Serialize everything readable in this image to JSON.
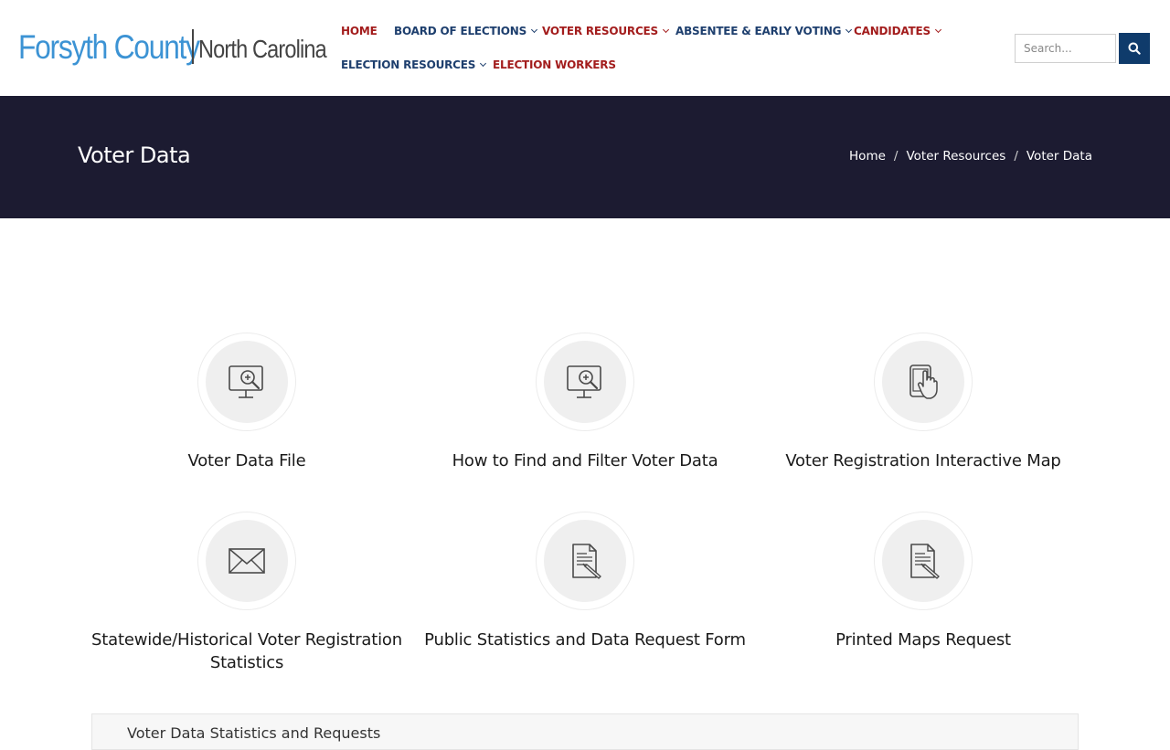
{
  "logo": {
    "county": "Forsyth County",
    "state": "North Carolina"
  },
  "nav": {
    "items": [
      {
        "label": "HOME",
        "dropdown": false
      },
      {
        "label": "BOARD OF ELECTIONS",
        "dropdown": true
      },
      {
        "label": "VOTER RESOURCES",
        "dropdown": true
      },
      {
        "label": "ABSENTEE & EARLY VOTING",
        "dropdown": true
      },
      {
        "label": "CANDIDATES",
        "dropdown": true
      },
      {
        "label": "ELECTION RESOURCES",
        "dropdown": true
      },
      {
        "label": "ELECTION WORKERS",
        "dropdown": false
      }
    ]
  },
  "search": {
    "placeholder": "Search...",
    "value": "",
    "button_icon": "search-icon"
  },
  "banner": {
    "title": "Voter Data",
    "breadcrumb": [
      "Home",
      "Voter Resources",
      "Voter Data"
    ],
    "breadcrumb_separator": "/"
  },
  "cards": [
    {
      "label": "Voter Data File",
      "icon": "monitor-magnifier-icon"
    },
    {
      "label": "How to Find and Filter Voter Data",
      "icon": "monitor-magnifier-icon"
    },
    {
      "label": "Voter Registration Interactive Map",
      "icon": "tablet-touch-icon"
    },
    {
      "label": "Statewide/Historical Voter Registration Statistics",
      "icon": "envelope-icon"
    },
    {
      "label": "Public Statistics and Data Request Form",
      "icon": "document-pen-icon"
    },
    {
      "label": "Printed Maps Request",
      "icon": "document-pen-icon"
    }
  ],
  "bottom_section": {
    "label": "Voter Data Statistics and Requests"
  },
  "colors": {
    "brand_blue": "#3c93d4",
    "nav_red": "#a31d1d",
    "nav_blue": "#1e3f6e",
    "banner_bg": "#1c1b31",
    "search_button": "#0f3b6b"
  }
}
